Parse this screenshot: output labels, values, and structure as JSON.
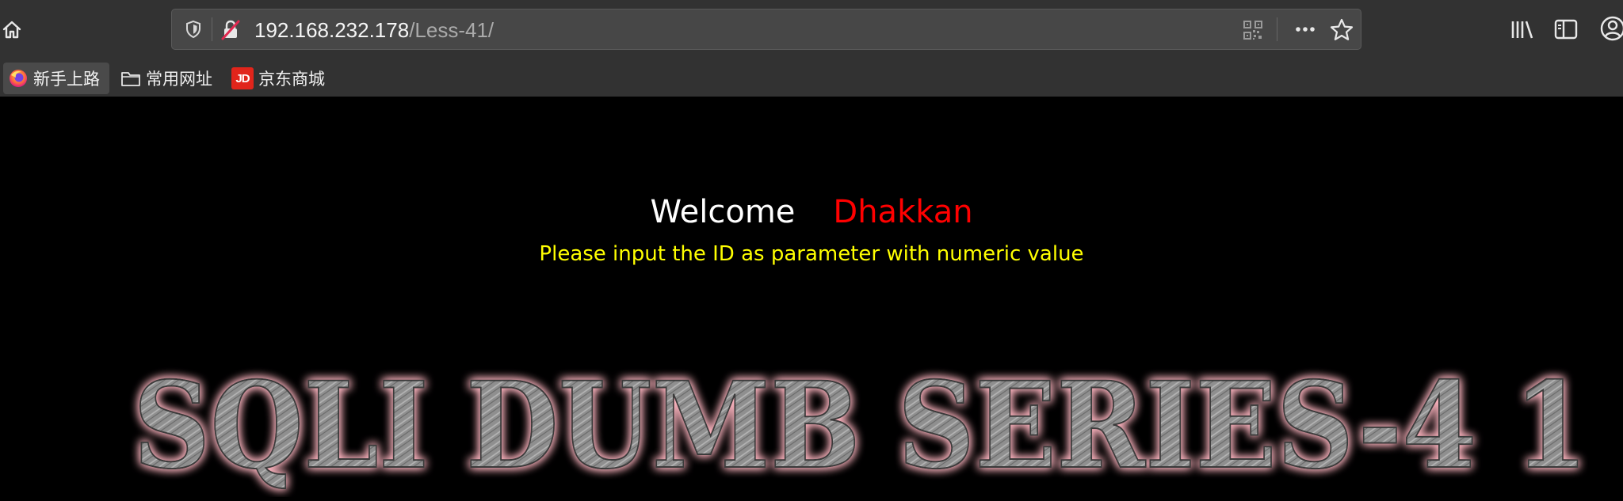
{
  "browser": {
    "url_host": "192.168.232.178",
    "url_path": "/Less-41/",
    "bookmarks": [
      {
        "label": "新手上路",
        "icon": "firefox-icon"
      },
      {
        "label": "常用网址",
        "icon": "folder-icon"
      },
      {
        "label": "京东商城",
        "icon": "jd-icon",
        "icon_text": "JD"
      }
    ]
  },
  "content": {
    "welcome": "Welcome",
    "name": "Dhakkan",
    "instruction": "Please input the ID as parameter with numeric value",
    "banner_text": "SQLI DUMB SERIES-4 1"
  },
  "colors": {
    "page_background": "#000000",
    "welcome": "#ffffff",
    "name": "#ff0000",
    "instruction": "#ffff00",
    "banner_glow": "#ffb6c1",
    "banner_fill": "#8c8c8c"
  }
}
